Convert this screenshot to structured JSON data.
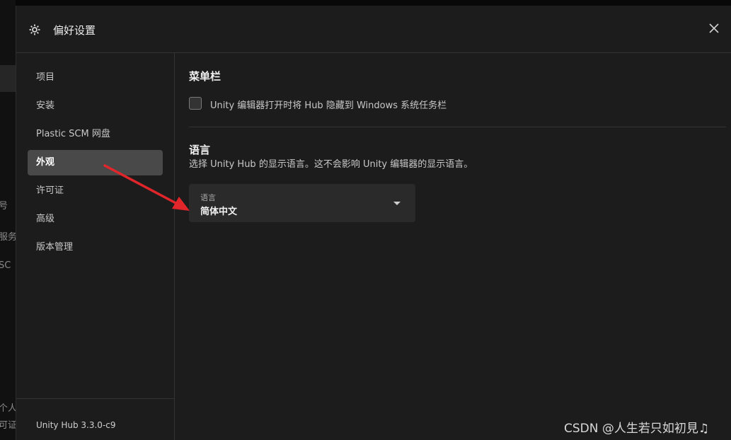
{
  "background": {
    "fragments": [
      "号",
      "服务",
      "SC",
      "个人",
      "可证"
    ]
  },
  "dialog": {
    "title": "偏好设置",
    "icon": "gear-icon",
    "close_icon": "close-icon"
  },
  "sidebar": {
    "items": [
      {
        "label": "项目",
        "active": false
      },
      {
        "label": "安装",
        "active": false
      },
      {
        "label": "Plastic SCM 网盘",
        "active": false
      },
      {
        "label": "外观",
        "active": true
      },
      {
        "label": "许可证",
        "active": false
      },
      {
        "label": "高级",
        "active": false
      },
      {
        "label": "版本管理",
        "active": false
      }
    ],
    "version": "Unity Hub 3.3.0-c9"
  },
  "main": {
    "menubar": {
      "title": "菜单栏",
      "checkbox_label": "Unity 编辑器打开时将 Hub 隐藏到 Windows 系统任务栏",
      "checked": false
    },
    "language": {
      "title": "语言",
      "description": "选择 Unity Hub 的显示语言。这不会影响 Unity 编辑器的显示语言。",
      "select_label": "语言",
      "select_value": "简体中文"
    }
  },
  "annotation": {
    "color": "#e0262a"
  },
  "watermark": "CSDN @人生若只如初見♫"
}
